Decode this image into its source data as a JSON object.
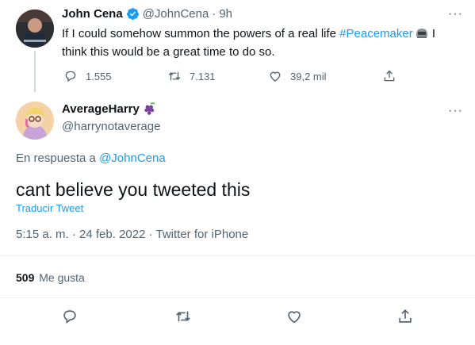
{
  "parent": {
    "name": "John Cena",
    "handle": "@JohnCena",
    "time": "9h",
    "text_a": "If I could somehow summon the powers of a real life ",
    "hashtag": "#Peacemaker",
    "text_b": " I",
    "text_line2": "think this would be a great time to do so.",
    "replies": "1.555",
    "retweets": "7.131",
    "likes": "39,2 mil",
    "more": "···"
  },
  "reply": {
    "name": "AverageHarry",
    "handle": "@harrynotaverage",
    "in_reply_prefix": "En respuesta a ",
    "in_reply_handle": "@JohnCena",
    "text": "cant believe you tweeted this",
    "translate": "Traducir Tweet",
    "meta": "5:15 a. m. · 24 feb. 2022 · Twitter for iPhone",
    "likes_count": "509",
    "likes_label": "Me gusta",
    "more": "···"
  },
  "colors": {
    "accent": "#1d9bf0",
    "muted": "#536471",
    "text": "#0f1419",
    "divider": "#eff3f4"
  },
  "icons": [
    "verified-badge-icon",
    "reply-icon",
    "retweet-icon",
    "like-icon",
    "share-icon",
    "grapes-emoji-icon",
    "peacemaker-helmet-emoji-icon"
  ]
}
